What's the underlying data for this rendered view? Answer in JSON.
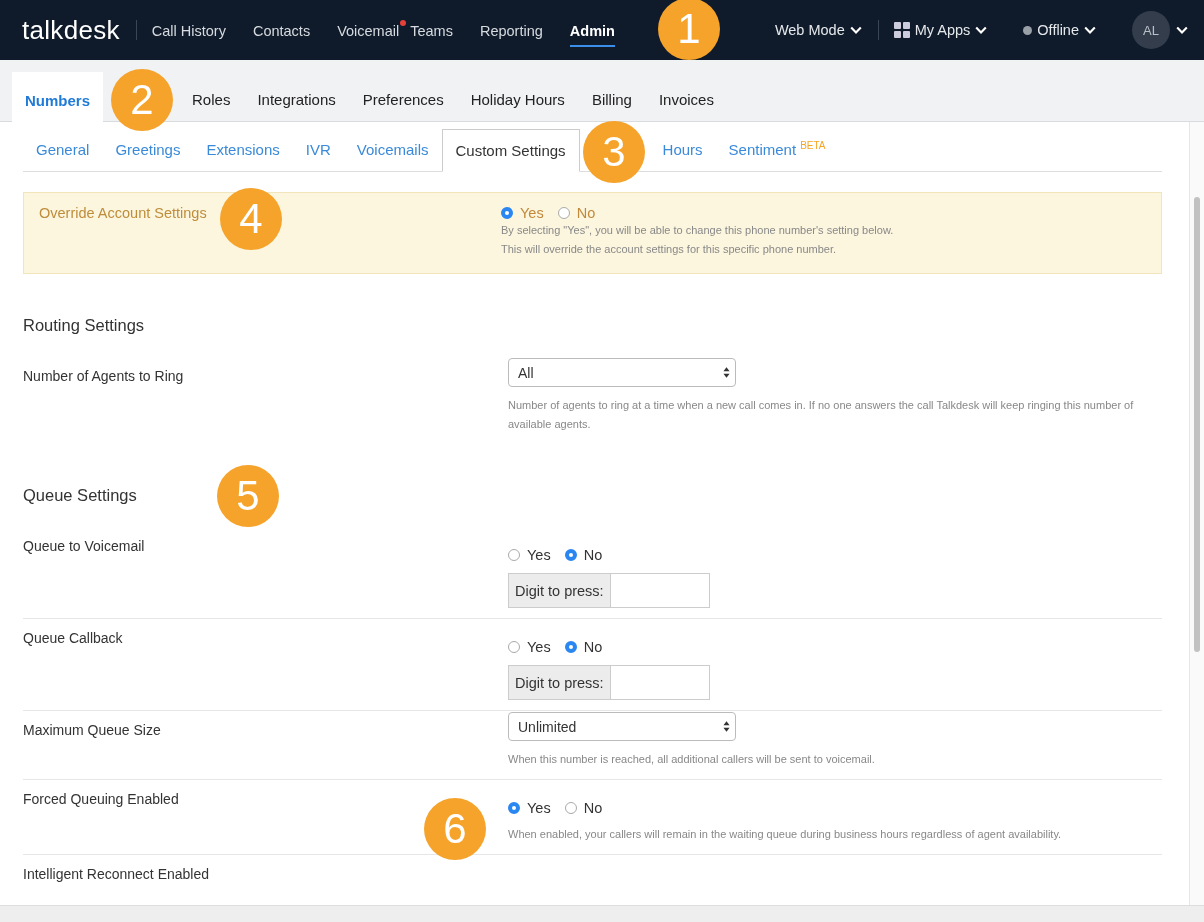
{
  "top_nav": {
    "logo": "talkdesk",
    "items": [
      {
        "label": "Call History",
        "selected": false,
        "notification": false
      },
      {
        "label": "Contacts",
        "selected": false,
        "notification": false
      },
      {
        "label": "Voicemail",
        "selected": false,
        "notification": true
      },
      {
        "label": "Teams",
        "selected": false,
        "notification": false
      },
      {
        "label": "Reporting",
        "selected": false,
        "notification": false
      },
      {
        "label": "Admin",
        "selected": true,
        "notification": false
      }
    ],
    "mode_menu": "Web Mode",
    "apps_menu": "My Apps",
    "status": "Offline",
    "avatar": "AL"
  },
  "main_tabs": [
    {
      "label": "Numbers",
      "selected": true
    },
    {
      "label": "Roles",
      "selected": false
    },
    {
      "label": "Integrations",
      "selected": false
    },
    {
      "label": "Preferences",
      "selected": false
    },
    {
      "label": "Holiday Hours",
      "selected": false
    },
    {
      "label": "Billing",
      "selected": false
    },
    {
      "label": "Invoices",
      "selected": false
    }
  ],
  "sub_tabs": [
    {
      "label": "General",
      "selected": false
    },
    {
      "label": "Greetings",
      "selected": false
    },
    {
      "label": "Extensions",
      "selected": false
    },
    {
      "label": "IVR",
      "selected": false
    },
    {
      "label": "Voicemails",
      "selected": false
    },
    {
      "label": "Custom Settings",
      "selected": true
    },
    {
      "label": "Hours",
      "selected": false
    },
    {
      "label": "Sentiment",
      "selected": false,
      "badge": "BETA"
    }
  ],
  "override": {
    "label": "Override Account Settings",
    "options": [
      {
        "label": "Yes",
        "selected": true
      },
      {
        "label": "No",
        "selected": false
      }
    ],
    "help": [
      "By selecting \"Yes\", you will be able to change this phone number's setting below.",
      "This will override the account settings for this specific phone number."
    ]
  },
  "sections": [
    {
      "title": "Routing Settings",
      "rows": [
        {
          "kind": "select",
          "label": "Number of Agents to Ring",
          "value": "All",
          "help": "Number of agents to ring at a time when a new call comes in. If no one answers the call Talkdesk will keep ringing this number of available agents."
        }
      ]
    },
    {
      "title": "Queue Settings",
      "rows": [
        {
          "kind": "radio_digit",
          "label": "Queue to Voicemail",
          "options": [
            {
              "label": "Yes",
              "selected": false
            },
            {
              "label": "No",
              "selected": true
            }
          ],
          "digit_label": "Digit to press:"
        },
        {
          "kind": "radio_digit",
          "label": "Queue Callback",
          "options": [
            {
              "label": "Yes",
              "selected": false
            },
            {
              "label": "No",
              "selected": true
            }
          ],
          "digit_label": "Digit to press:"
        },
        {
          "kind": "select",
          "label": "Maximum Queue Size",
          "value": "Unlimited",
          "help": "When this number is reached, all additional callers will be sent to voicemail."
        },
        {
          "kind": "radio",
          "label": "Forced Queuing Enabled",
          "options": [
            {
              "label": "Yes",
              "selected": true
            },
            {
              "label": "No",
              "selected": false
            }
          ],
          "help": "When enabled, your callers will remain in the waiting queue during business hours regardless of agent availability."
        },
        {
          "kind": "label",
          "label": "Intelligent Reconnect Enabled"
        }
      ]
    }
  ],
  "annotations": [
    "1",
    "2",
    "3",
    "4",
    "5",
    "6"
  ]
}
